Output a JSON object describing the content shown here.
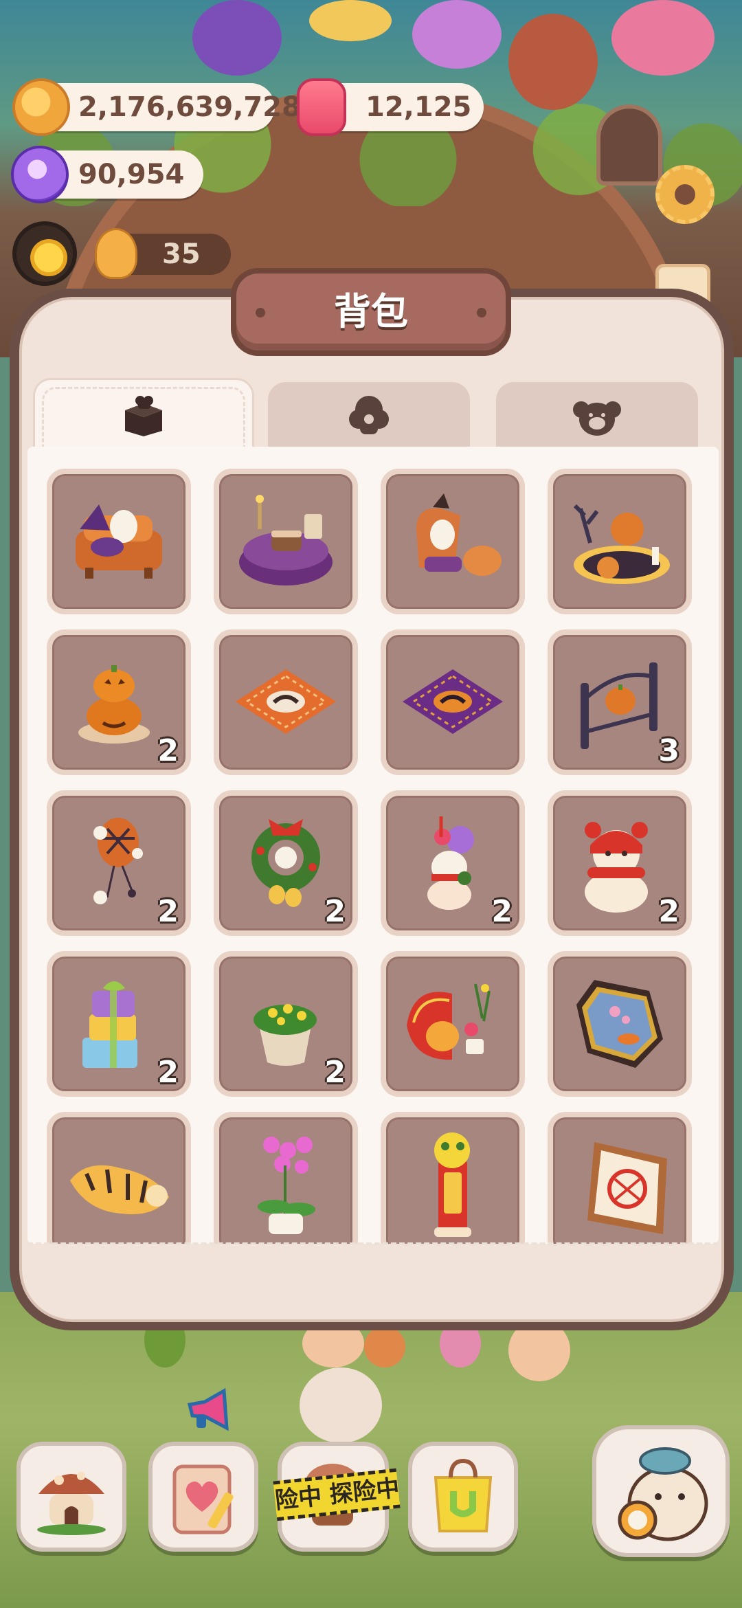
{
  "resources": {
    "coins": "2,176,639,728",
    "candles": "12,125",
    "gems": "90,954",
    "level": "35"
  },
  "modal": {
    "title": "背包",
    "tabs": [
      {
        "icon": "furniture-box-icon",
        "active": true
      },
      {
        "icon": "outfit-icon",
        "active": false
      },
      {
        "icon": "pet-icon",
        "active": false
      }
    ]
  },
  "items": [
    {
      "icon": "halloween-sofa-icon",
      "count": ""
    },
    {
      "icon": "halloween-dining-table-icon",
      "count": ""
    },
    {
      "icon": "pumpkin-armchair-set-icon",
      "count": ""
    },
    {
      "icon": "haunted-stage-icon",
      "count": ""
    },
    {
      "icon": "jack-o-lantern-stack-icon",
      "count": "2"
    },
    {
      "icon": "orange-cat-rug-icon",
      "count": ""
    },
    {
      "icon": "purple-cat-rug-icon",
      "count": ""
    },
    {
      "icon": "iron-pumpkin-gate-icon",
      "count": "3"
    },
    {
      "icon": "spider-balloon-icon",
      "count": "2"
    },
    {
      "icon": "christmas-wreath-icon",
      "count": "2"
    },
    {
      "icon": "candy-snowman-icon",
      "count": "2"
    },
    {
      "icon": "red-hat-snowman-icon",
      "count": "2"
    },
    {
      "icon": "gift-box-stack-icon",
      "count": "2"
    },
    {
      "icon": "flower-pot-icon",
      "count": "2"
    },
    {
      "icon": "lunar-new-year-fan-icon",
      "count": ""
    },
    {
      "icon": "plum-blossom-painting-icon",
      "count": ""
    },
    {
      "icon": "tiger-rug-icon",
      "count": ""
    },
    {
      "icon": "pink-orchid-icon",
      "count": ""
    },
    {
      "icon": "lion-dance-banner-icon",
      "count": ""
    },
    {
      "icon": "tiger-paper-cut-frame-icon",
      "count": ""
    }
  ],
  "bottom_nav": {
    "home": "mushroom-house-icon",
    "journal": "heart-notebook-icon",
    "adventure_tape": "险中 探险中",
    "shop": "shopping-bag-icon",
    "pet": "duck-alarm-clock-icon"
  },
  "colors": {
    "slot_bg": "#a88680",
    "slot_border": "#e9d3c6",
    "panel_bg": "#fbf6f1",
    "title_plate": "#a66a60",
    "count_text": "#ffffff"
  }
}
